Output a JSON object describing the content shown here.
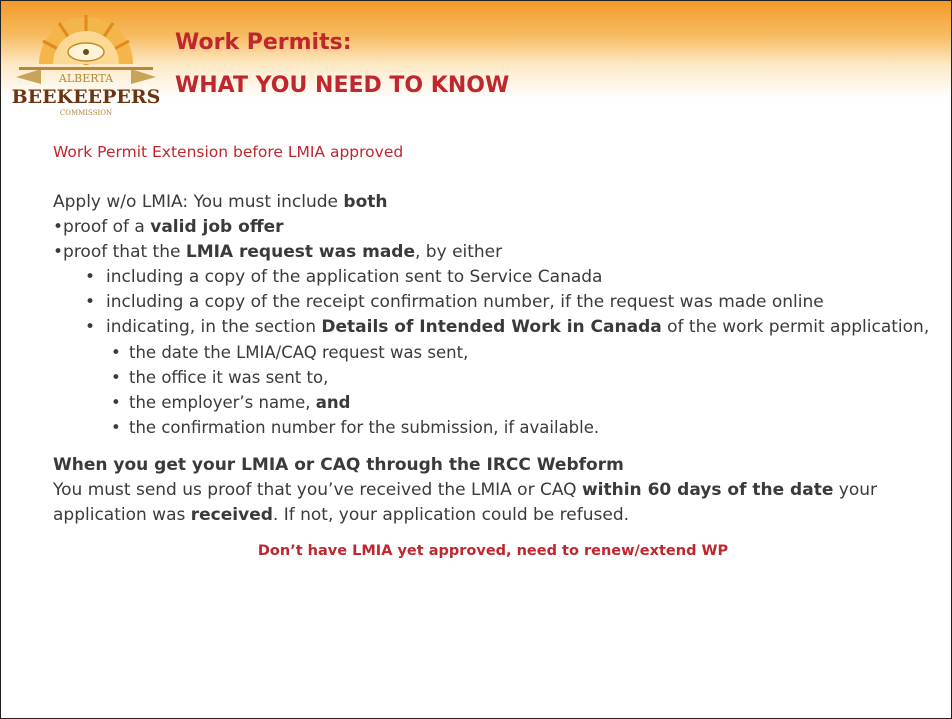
{
  "header": {
    "title_line1": "Work Permits:",
    "title_line2": "WHAT YOU NEED TO KNOW",
    "logo_text_top": "ALBERTA",
    "logo_text_main": "BEEKEEPERS",
    "logo_text_bottom": "COMMISSION"
  },
  "subtitle": "Work Permit Extension before LMIA approved",
  "intro": {
    "prefix": "Apply w/o LMIA: You must include ",
    "bold": "both"
  },
  "requirement1": {
    "prefix": "•proof of a ",
    "bold": "valid job offer"
  },
  "requirement2": {
    "prefix": "•proof that the ",
    "bold": "LMIA request was made",
    "suffix": ", by either"
  },
  "options": {
    "opt1": "including a copy of the application sent to Service Canada",
    "opt2": "including a copy of the receipt confirmation number, if the request was made online",
    "opt3": {
      "prefix": "indicating, in the section ",
      "bold": "Details of Intended Work in Canada",
      "suffix": " of the work permit application,"
    }
  },
  "details": {
    "d1": "the date the LMIA/CAQ request was sent,",
    "d2": "the office it was sent to,",
    "d3": {
      "prefix": "the employer’s name, ",
      "bold": "and"
    },
    "d4": "the confirmation number for the submission, if available."
  },
  "webform": {
    "heading": "When you get your LMIA or CAQ through the IRCC Webform",
    "text1": "You must send us proof that you’ve received the LMIA or CAQ ",
    "bold1": "within 60 days of the date",
    "text2": " your application was ",
    "bold2": "received",
    "text3": ". If not, your application could be refused."
  },
  "footer_note": "Don’t have LMIA yet approved, need to renew/extend WP",
  "colors": {
    "accent_red": "#c0262d",
    "header_orange": "#f39a2a",
    "text": "#3a3a3a"
  }
}
